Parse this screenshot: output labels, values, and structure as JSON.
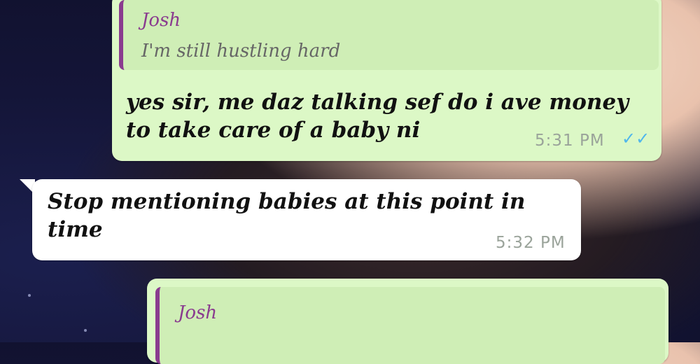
{
  "messages": [
    {
      "quote": {
        "author": "Josh",
        "text": "I'm still hustling hard"
      },
      "text": "yes sir, me daz talking sef do i ave money\nto take care of a baby ni",
      "time": "5:31 PM",
      "status_icon": "double-check-blue-icon",
      "status_glyph": "✓✓"
    },
    {
      "text": "Stop mentioning babies at this point in\ntime",
      "time": "5:32 PM"
    },
    {
      "quote": {
        "author": "Josh",
        "text": ""
      }
    }
  ],
  "colors": {
    "outgoing_bubble": "#dcf8c6",
    "incoming_bubble": "#ffffff",
    "quote_bar": "#8a3b8f",
    "read_ticks": "#4fb6ec"
  }
}
